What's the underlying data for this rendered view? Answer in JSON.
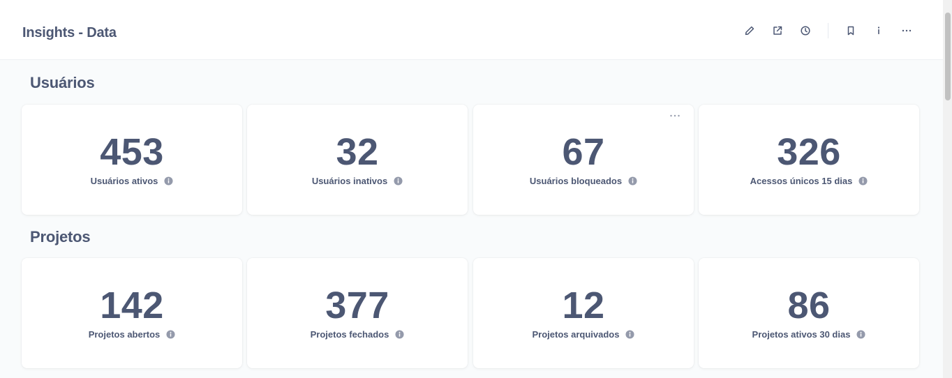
{
  "header": {
    "title": "Insights - Data",
    "actions": [
      {
        "name": "edit-icon"
      },
      {
        "name": "share-icon"
      },
      {
        "name": "history-icon"
      },
      {
        "name": "bookmark-icon"
      },
      {
        "name": "info-icon"
      },
      {
        "name": "more-icon"
      }
    ]
  },
  "sections": [
    {
      "title": "Usuários",
      "cards": [
        {
          "value": "453",
          "label": "Usuários ativos"
        },
        {
          "value": "32",
          "label": "Usuários inativos"
        },
        {
          "value": "67",
          "label": "Usuários bloqueados"
        },
        {
          "value": "326",
          "label": "Acessos únicos 15 dias"
        }
      ]
    },
    {
      "title": "Projetos",
      "cards": [
        {
          "value": "142",
          "label": "Projetos abertos"
        },
        {
          "value": "377",
          "label": "Projetos fechados"
        },
        {
          "value": "12",
          "label": "Projetos arquivados"
        },
        {
          "value": "86",
          "label": "Projetos ativos 30 dias"
        }
      ]
    }
  ],
  "colors": {
    "text": "#4c5773",
    "muted": "#949aab",
    "background": "#f9fbfc",
    "card": "#ffffff"
  }
}
